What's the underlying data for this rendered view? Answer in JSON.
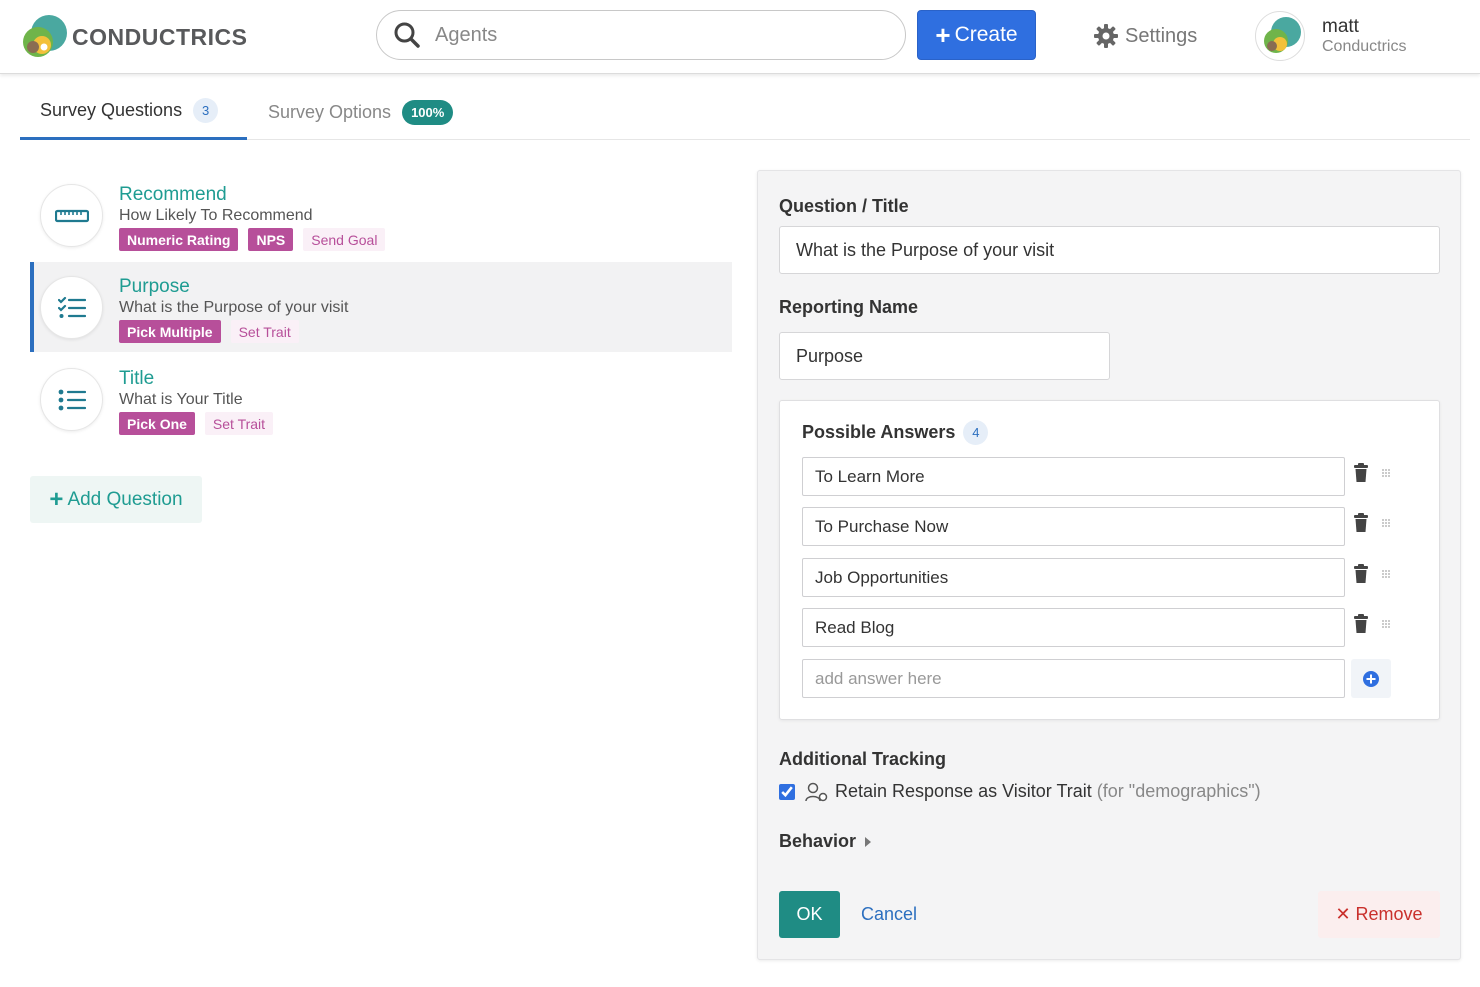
{
  "header": {
    "logo_text": "CONDUCTRICS",
    "search_placeholder": "Agents",
    "create_label": "Create",
    "settings_label": "Settings",
    "user_name": "matt",
    "user_org": "Conductrics"
  },
  "tabs": [
    {
      "label": "Survey Questions",
      "badge": "3",
      "active": true
    },
    {
      "label": "Survey Options",
      "badge": "100%",
      "active": false
    }
  ],
  "questions": [
    {
      "title": "Recommend",
      "subtitle": "How Likely To Recommend",
      "tags": [
        "Numeric Rating",
        "NPS",
        "Send Goal"
      ],
      "icon": "ruler-icon"
    },
    {
      "title": "Purpose",
      "subtitle": "What is the Purpose of your visit",
      "tags": [
        "Pick Multiple",
        "Set Trait"
      ],
      "icon": "checklist-icon"
    },
    {
      "title": "Title",
      "subtitle": "What is Your Title",
      "tags": [
        "Pick One",
        "Set Trait"
      ],
      "icon": "list-icon"
    }
  ],
  "add_question_label": "Add Question",
  "editor": {
    "question_label": "Question / Title",
    "question_value": "What is the Purpose of your visit",
    "reporting_label": "Reporting Name",
    "reporting_value": "Purpose",
    "answers_label": "Possible Answers",
    "answers_count": "4",
    "answers": [
      "To Learn More",
      "To Purchase Now",
      "Job Opportunities",
      "Read Blog"
    ],
    "add_answer_placeholder": "add answer here",
    "tracking_label": "Additional Tracking",
    "retain_label": "Retain Response as Visitor Trait",
    "retain_note": "(for \"demographics\")",
    "retain_checked": true,
    "behavior_label": "Behavior",
    "ok_label": "OK",
    "cancel_label": "Cancel",
    "remove_label": "Remove"
  },
  "colors": {
    "accent_blue": "#2f6fe0",
    "teal": "#1f9c92",
    "tag_magenta": "#b74f9a",
    "remove_red": "#c9302c"
  }
}
